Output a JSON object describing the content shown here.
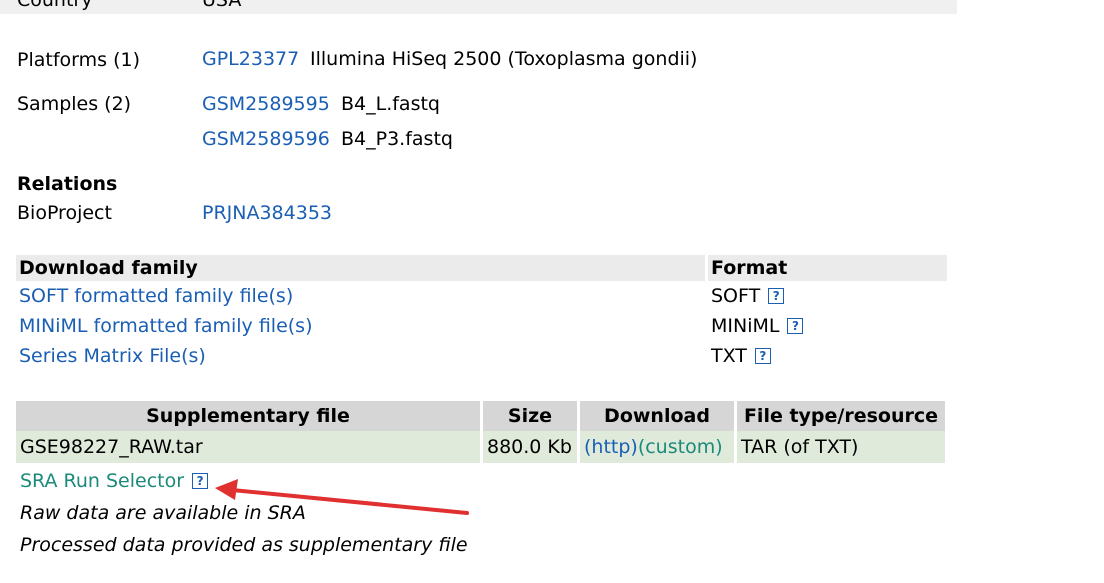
{
  "country": {
    "label": "Country",
    "value": "USA"
  },
  "platforms": {
    "label": "Platforms (1)",
    "id": "GPL23377",
    "name": "Illumina HiSeq 2500 (Toxoplasma gondii)"
  },
  "samples": {
    "label": "Samples (2)",
    "items": [
      {
        "id": "GSM2589595",
        "name": "B4_L.fastq"
      },
      {
        "id": "GSM2589596",
        "name": "B4_P3.fastq"
      }
    ]
  },
  "relations": {
    "heading": "Relations",
    "bioproject_label": "BioProject",
    "bioproject_id": "PRJNA384353"
  },
  "download_family": {
    "headers": {
      "family": "Download family",
      "format": "Format"
    },
    "rows": [
      {
        "label": "SOFT formatted family file(s)",
        "format": "SOFT"
      },
      {
        "label": "MINiML formatted family file(s)",
        "format": "MINiML"
      },
      {
        "label": "Series Matrix File(s)",
        "format": "TXT"
      }
    ]
  },
  "supplementary": {
    "headers": {
      "file": "Supplementary file",
      "size": "Size",
      "download": "Download",
      "type": "File type/resource"
    },
    "row": {
      "file": "GSE98227_RAW.tar",
      "size": "880.0 Kb",
      "http": "(http)",
      "custom": "(custom)",
      "type": "TAR (of TXT)"
    }
  },
  "sra_link": "SRA Run Selector",
  "notes": [
    "Raw data are available in SRA",
    "Processed data provided as supplementary file"
  ],
  "help_glyph": "?",
  "colors": {
    "link": "#1a5fb4",
    "teal": "#1b8a7a",
    "arrow": "#e03030",
    "row_bg": "#dfeadb",
    "header_bg": "#d6d6d6"
  }
}
